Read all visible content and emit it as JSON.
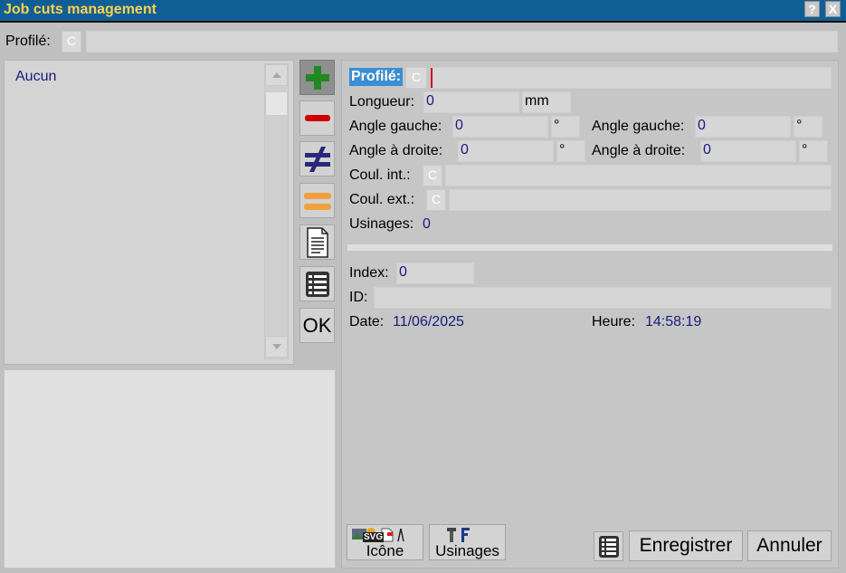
{
  "window": {
    "title": "Job cuts management",
    "help_label": "?",
    "close_label": "X"
  },
  "top": {
    "profile_label": "Profilé:",
    "c_label": "C",
    "profile_value": ""
  },
  "list": {
    "items": [
      "Aucun"
    ]
  },
  "form": {
    "profile_label": "Profilé:",
    "c_label": "C",
    "profile_value": "",
    "length_label": "Longueur:",
    "length_value": "0",
    "length_unit": "mm",
    "angle_left_label": "Angle gauche:",
    "angle_left_value": "0",
    "angle_left2_label": "Angle gauche:",
    "angle_left2_value": "0",
    "angle_right_label": "Angle à droite:",
    "angle_right_value": "0",
    "angle_right2_label": "Angle à droite:",
    "angle_right2_value": "0",
    "degree_unit": "°",
    "int_color_label": "Coul. int.:",
    "ext_color_label": "Coul. ext.:",
    "machinings_label": "Usinages:",
    "machinings_value": "0",
    "index_label": "Index:",
    "index_value": "0",
    "id_label": "ID:",
    "id_value": "",
    "date_label": "Date:",
    "date_value": "11/06/2025",
    "time_label": "Heure:",
    "time_value": "14:58:19"
  },
  "toolbar": {
    "ok_label": "OK"
  },
  "bottom": {
    "icon_label": "Icône",
    "icon_badge": "SVG",
    "machinings_label": "Usinages",
    "save_label": "Enregistrer",
    "cancel_label": "Annuler"
  },
  "colors": {
    "titlebar": "#0f5f96",
    "title_text": "#ffd24a",
    "value_text": "#1a1a80",
    "add_green": "#1f8a1f",
    "remove_red": "#d00000",
    "neq_blue": "#28287a",
    "eq_orange": "#f0a040",
    "highlight": "#3a8ed4"
  }
}
